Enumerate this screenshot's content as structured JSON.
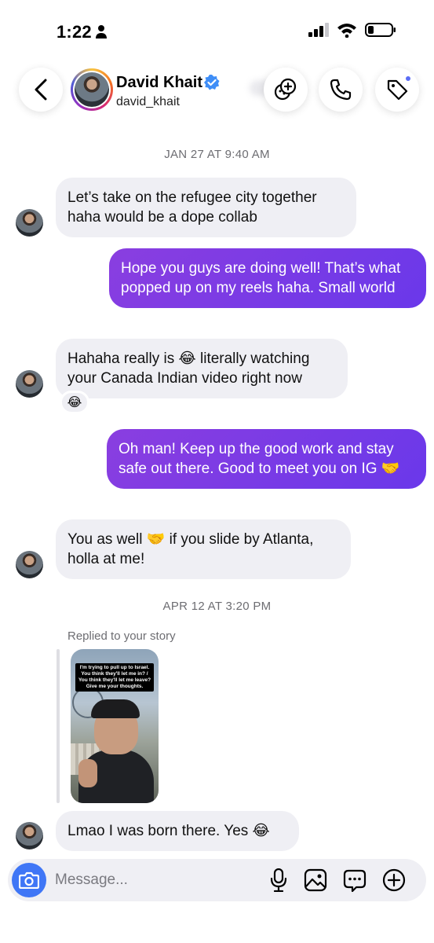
{
  "status_bar": {
    "time": "1:22"
  },
  "header": {
    "name": "David Khait",
    "handle": "david_khait"
  },
  "timestamps": [
    "JAN 27 AT 9:40 AM",
    "APR 12 AT 3:20 PM"
  ],
  "messages": [
    {
      "sender": "them",
      "text": "Let’s take on the refugee city together haha would be a dope collab"
    },
    {
      "sender": "me",
      "text": "Hope you guys are doing well! That’s what popped up on my reels haha. Small world"
    },
    {
      "sender": "them",
      "text": "Hahaha really is 😂 literally watching your Canada Indian video right now",
      "reaction": "😂"
    },
    {
      "sender": "me",
      "text": "Oh man! Keep up the good work and stay safe out there. Good to meet you on IG 🤝"
    },
    {
      "sender": "them",
      "text": "You as well 🤝 if you slide by Atlanta, holla at me!"
    },
    {
      "sender": "them",
      "text": "Lmao I was born there. Yes 😂"
    }
  ],
  "story_reply": {
    "label": "Replied to your story",
    "caption": "I'm trying to pull up to Israel. You think they'll let me in? / You think they'll let me leave? Give me your thoughts."
  },
  "composer": {
    "placeholder": "Message..."
  },
  "colors": {
    "outgoing_bubble": "#7c3aed",
    "incoming_bubble": "#efeff4",
    "camera_button": "#3f76f6",
    "verified": "#3f8ef7"
  }
}
